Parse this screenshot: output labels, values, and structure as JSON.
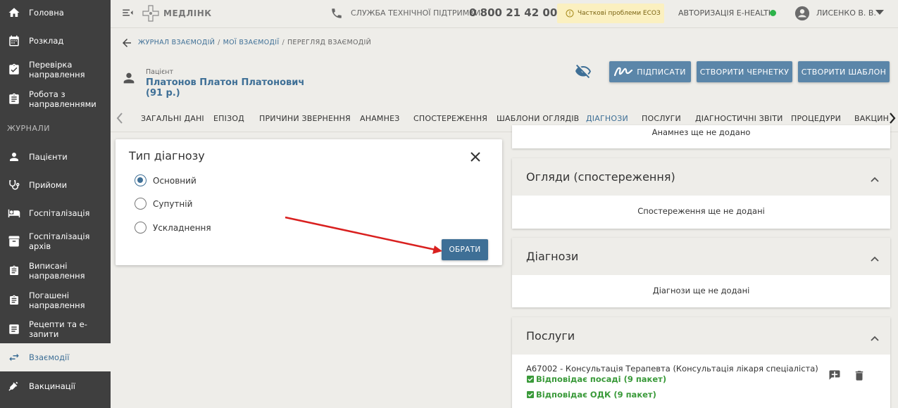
{
  "sidebar": {
    "items": [
      {
        "label": "Головна",
        "icon": "home-icon"
      },
      {
        "label": "Розклад",
        "icon": "calendar-icon"
      },
      {
        "label": "Перевірка направлення",
        "icon": "clipboard-check-icon"
      },
      {
        "label": "Робота з направленнями",
        "icon": "clipboard-icon"
      }
    ],
    "section": "ЖУРНАЛИ",
    "journal_items": [
      {
        "label": "Пацієнти",
        "icon": "person-icon"
      },
      {
        "label": "Прийоми",
        "icon": "stethoscope-icon"
      },
      {
        "label": "Госпіталізація",
        "icon": "bed-icon"
      },
      {
        "label": "Госпіталізація архів",
        "icon": "archive-icon"
      },
      {
        "label": "Виписані направлення",
        "icon": "clipboard-icon"
      },
      {
        "label": "Погашені направлення",
        "icon": "clipboard-icon"
      },
      {
        "label": "Рецепти та е-запити",
        "icon": "list-icon"
      },
      {
        "label": "Взаємодії",
        "icon": "swap-icon"
      },
      {
        "label": "Вакцинації",
        "icon": "syringe-icon"
      }
    ]
  },
  "topbar": {
    "brand": "МЕДЛІНК",
    "support_label": "СЛУЖБА ТЕХНІЧНОЇ ПІДТРИМКИ",
    "support_phone": "0 800 21 42 00",
    "warning": "Часткові проблеми ЕСОЗ",
    "auth_label": "АВТОРИЗАЦІЯ E-HEALTH",
    "auth_status_color": "#2db34a",
    "user": "ЛИСЕНКО В. В."
  },
  "breadcrumb": [
    "ЖУРНАЛ ВЗАЄМОДІЙ",
    "МОЇ ВЗАЄМОДІЇ",
    "ПЕРЕГЛЯД ВЗАЄМОДІЙ"
  ],
  "patient": {
    "label": "Пацієнт",
    "name": "Платонов Платон Платонович (91 р.)"
  },
  "actions": {
    "sign": "ПІДПИСАТИ",
    "draft": "СТВОРИТИ ЧЕРНЕТКУ",
    "template": "СТВОРИТИ ШАБЛОН"
  },
  "tabs": [
    "ЗАГАЛЬНІ ДАНІ",
    "ЕПІЗОД",
    "ПРИЧИНИ ЗВЕРНЕННЯ",
    "АНАМНЕЗ",
    "СПОСТЕРЕЖЕННЯ",
    "ШАБЛОНИ ОГЛЯДІВ",
    "ДІАГНОЗИ",
    "ПОСЛУГИ",
    "ДІАГНОСТИЧНІ ЗВІТИ",
    "ПРОЦЕДУРИ",
    "ВАКЦИН"
  ],
  "active_tab": "ДІАГНОЗИ",
  "dialog": {
    "title": "Тип діагнозу",
    "options": [
      "Основний",
      "Супутній",
      "Ускладнення"
    ],
    "selected": "Основний",
    "submit": "ОБРАТИ"
  },
  "cards": {
    "anamnesis_empty": "Анамнез ще не додано",
    "observations": {
      "title": "Огляди (спостереження)",
      "empty": "Спостереження ще не додані"
    },
    "diagnoses": {
      "title": "Діагнози",
      "empty": "Діагнози ще не додані"
    },
    "services": {
      "title": "Послуги",
      "item": "А67002 - Консультація Терапевта (Консультація лікаря спеціаліста)",
      "check1": "Відповідає посаді (9 пакет)",
      "check2": "Відповідає ОДК (9 пакет)"
    }
  },
  "colors": {
    "accent": "#3e6f96",
    "sidebar": "#3f3f3f",
    "check": "#3a9a3a",
    "arrow": "#d9201f"
  }
}
